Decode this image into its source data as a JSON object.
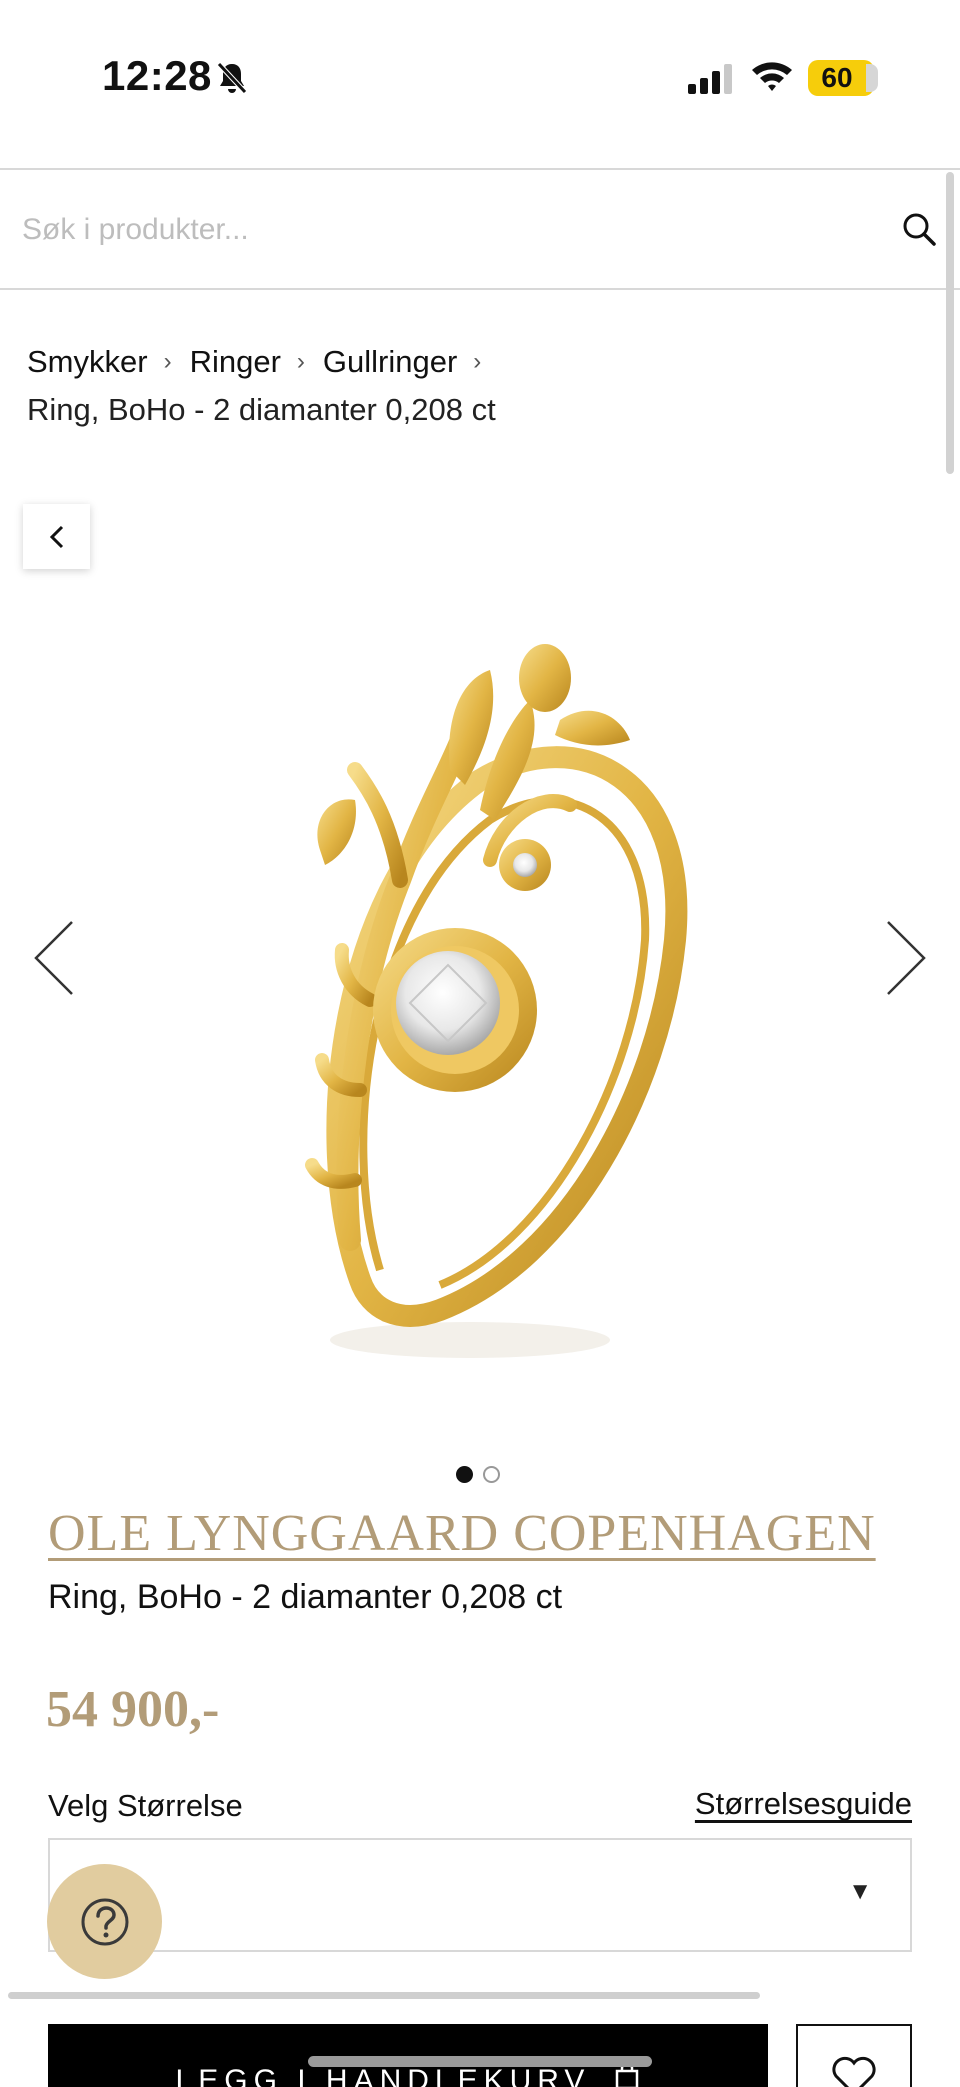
{
  "status_bar": {
    "time": "12:28",
    "battery": "60"
  },
  "search": {
    "placeholder": "Søk i produkter..."
  },
  "breadcrumb": {
    "items": [
      "Smykker",
      "Ringer",
      "Gullringer"
    ],
    "separator": "›",
    "current": "Ring, BoHo - 2 diamanter 0,208 ct"
  },
  "product": {
    "brand": "OLE LYNGGAARD COPENHAGEN",
    "name": "Ring, BoHo - 2 diamanter 0,208 ct",
    "price": "54 900,-",
    "image_count": 2,
    "active_image": 1
  },
  "size": {
    "label": "Velg Størrelse",
    "guide_link": "Størrelsesguide",
    "selected": ""
  },
  "actions": {
    "add_to_cart": "LEGG I HANDLEKURV"
  },
  "colors": {
    "accent_gold": "#b29c78",
    "help_button": "#e1cc9f",
    "primary_button": "#000000"
  },
  "icons": [
    "bell-slash-icon",
    "signal-icon",
    "wifi-icon",
    "search-icon",
    "chevron-left-icon",
    "arrow-left-icon",
    "arrow-right-icon",
    "help-icon",
    "bag-icon",
    "heart-icon"
  ]
}
